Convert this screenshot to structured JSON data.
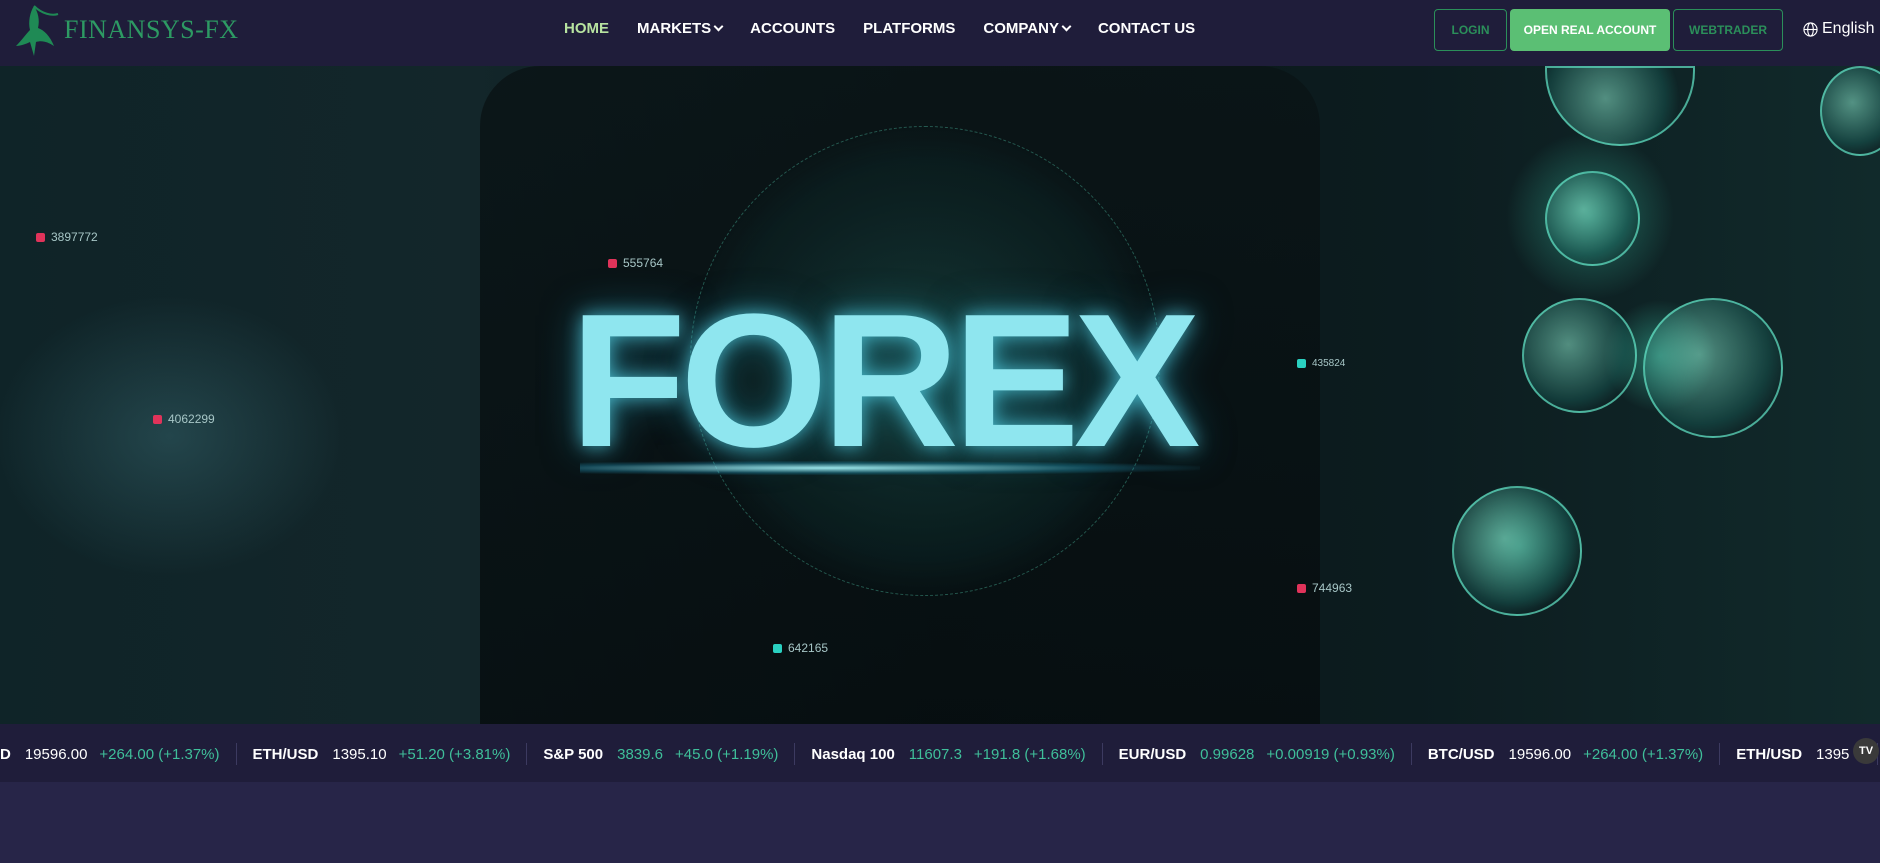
{
  "brand": {
    "name": "FINANSYS-FX",
    "logo_icon": "bull-icon"
  },
  "nav": {
    "items": [
      {
        "label": "HOME",
        "active": true,
        "dropdown": false
      },
      {
        "label": "MARKETS",
        "active": false,
        "dropdown": true
      },
      {
        "label": "ACCOUNTS",
        "active": false,
        "dropdown": false
      },
      {
        "label": "PLATFORMS",
        "active": false,
        "dropdown": false
      },
      {
        "label": "COMPANY",
        "active": false,
        "dropdown": true
      },
      {
        "label": "CONTACT US",
        "active": false,
        "dropdown": false
      }
    ],
    "login": "LOGIN",
    "open_account": "OPEN REAL ACCOUNT",
    "webtrader": "WEBTRADER",
    "language": "English",
    "language_icon": "globe-icon"
  },
  "hero": {
    "headline": "FOREX",
    "hud_numbers": [
      "3897772",
      "555764",
      "4062299",
      "435824",
      "744963",
      "642165"
    ]
  },
  "ticker": {
    "items": [
      {
        "symbol": "D",
        "price": "19596.00",
        "change": "+264.00 (+1.37%)",
        "price_green": false
      },
      {
        "symbol": "ETH/USD",
        "price": "1395.10",
        "change": "+51.20 (+3.81%)",
        "price_green": false
      },
      {
        "symbol": "S&P 500",
        "price": "3839.6",
        "change": "+45.0 (+1.19%)",
        "price_green": true
      },
      {
        "symbol": "Nasdaq 100",
        "price": "11607.3",
        "change": "+191.8 (+1.68%)",
        "price_green": true
      },
      {
        "symbol": "EUR/USD",
        "price": "0.99628",
        "change": "+0.00919 (+0.93%)",
        "price_green": true
      },
      {
        "symbol": "BTC/USD",
        "price": "19596.00",
        "change": "+264.00 (+1.37%)",
        "price_green": false
      },
      {
        "symbol": "ETH/USD",
        "price": "1395",
        "change": "",
        "price_green": false
      }
    ],
    "badge": "TV"
  },
  "colors": {
    "nav_bg": "#1f1d3a",
    "page_bg": "#272548",
    "accent_green": "#5bbf74",
    "active_nav": "#b7e3a0",
    "ticker_up": "#3fbf9a"
  }
}
